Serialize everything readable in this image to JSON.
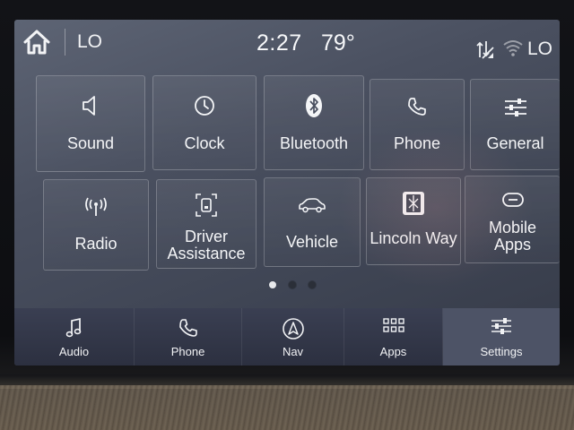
{
  "status": {
    "left_temp": "LO",
    "time": "2:27",
    "outside_temp": "79°",
    "right_temp": "LO"
  },
  "tiles": [
    {
      "label": "Sound",
      "icon": "speaker-icon"
    },
    {
      "label": "Clock",
      "icon": "clock-icon"
    },
    {
      "label": "Bluetooth",
      "icon": "bluetooth-icon"
    },
    {
      "label": "Phone",
      "icon": "phone-icon"
    },
    {
      "label": "General",
      "icon": "sliders-icon"
    },
    {
      "label": "Radio",
      "icon": "antenna-icon"
    },
    {
      "label": "Driver Assistance",
      "label_line1": "Driver",
      "label_line2": "Assistance",
      "icon": "driver-assist-icon"
    },
    {
      "label": "Vehicle",
      "icon": "car-icon"
    },
    {
      "label": "Lincoln Way",
      "icon": "lincoln-logo-icon"
    },
    {
      "label": "Mobile Apps",
      "label_line1": "Mobile",
      "label_line2": "Apps",
      "icon": "mobile-apps-icon"
    }
  ],
  "pagination": {
    "current_page": 1,
    "total_pages": 3
  },
  "nav": [
    {
      "label": "Audio",
      "icon": "music-note-icon"
    },
    {
      "label": "Phone",
      "icon": "phone-icon"
    },
    {
      "label": "Nav",
      "icon": "navigation-arrow-icon"
    },
    {
      "label": "Apps",
      "icon": "apps-grid-icon"
    },
    {
      "label": "Settings",
      "icon": "sliders-icon",
      "active": true
    }
  ],
  "colors": {
    "screen_bg": "#4a5060",
    "nav_bg": "#33374a",
    "active_nav": "#4d5366",
    "text": "#f4f5f7"
  }
}
